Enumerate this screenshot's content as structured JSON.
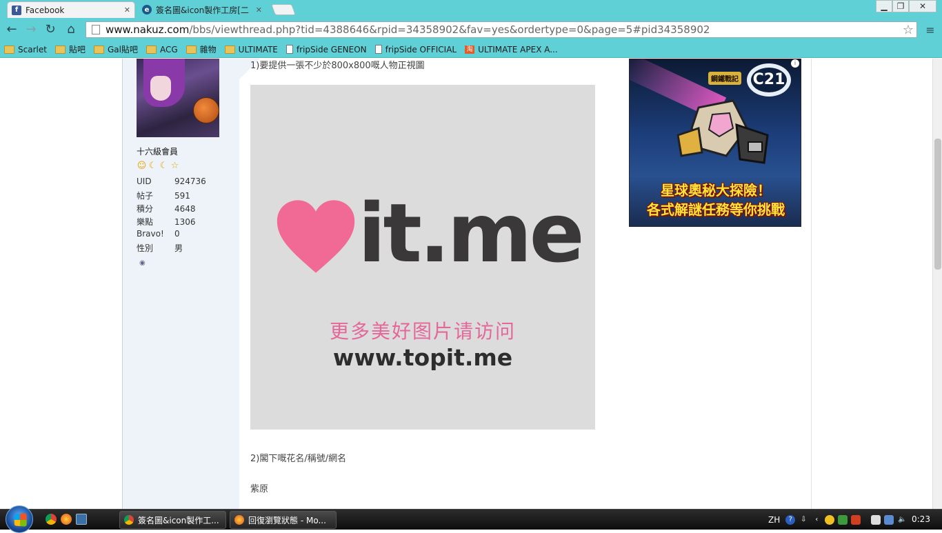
{
  "browser": {
    "tabs": [
      {
        "title": "Facebook",
        "favicon_color": "#3b5998",
        "favicon_letter": "f"
      },
      {
        "title": "簽名圖&icon製作工房[二",
        "favicon_color": "#1a5a8a",
        "favicon_letter": "e"
      }
    ],
    "url_host": "www.nakuz.com",
    "url_path": "/bbs/viewthread.php?tid=4388646&rpid=34358902&fav=yes&ordertype=0&page=5#pid34358902",
    "bookmarks": [
      {
        "label": "Scarlet",
        "type": "folder"
      },
      {
        "label": "貼吧",
        "type": "folder"
      },
      {
        "label": "Gal貼吧",
        "type": "folder"
      },
      {
        "label": "ACG",
        "type": "folder"
      },
      {
        "label": "雜物",
        "type": "folder"
      },
      {
        "label": "ULTIMATE",
        "type": "folder"
      },
      {
        "label": "fripSide GENEON",
        "type": "page"
      },
      {
        "label": "fripSide OFFICIAL",
        "type": "page"
      },
      {
        "label": "ULTIMATE APEX A...",
        "type": "taobao"
      }
    ]
  },
  "profile": {
    "rank": "十六級會員",
    "stats": [
      {
        "key": "UID",
        "value": "924736"
      },
      {
        "key": "帖子",
        "value": "591"
      },
      {
        "key": "積分",
        "value": "4648"
      },
      {
        "key": "樂點",
        "value": "1306"
      },
      {
        "key": "Bravo!",
        "value": "0"
      },
      {
        "key": "性別",
        "value": "男"
      }
    ]
  },
  "post": {
    "line1": "1)要提供一張不少於800x800嘅人物正視圖",
    "image": {
      "logo_text": "it.me",
      "cn_text": "更多美好图片请访问",
      "url_text": "www.topit.me"
    },
    "line2": "2)閣下嘅花名/稱號/網名",
    "line3": "紫原"
  },
  "ad": {
    "badge": "鋼鐵戰記",
    "logo": "C21",
    "caption1": "星球奧秘大探險！",
    "caption2": "各式解謎任務等你挑戰"
  },
  "taskbar": {
    "tasks": [
      {
        "title": "簽名圖&icon製作工...",
        "icon_color": "#3aa0e0"
      },
      {
        "title": "回復瀏覽狀態 - Mo...",
        "icon_color": "#e07a1a"
      }
    ],
    "lang": "ZH",
    "clock": "0:23"
  },
  "colors": {
    "chrome": "#5fd0d6",
    "heart": "#f06a95"
  }
}
